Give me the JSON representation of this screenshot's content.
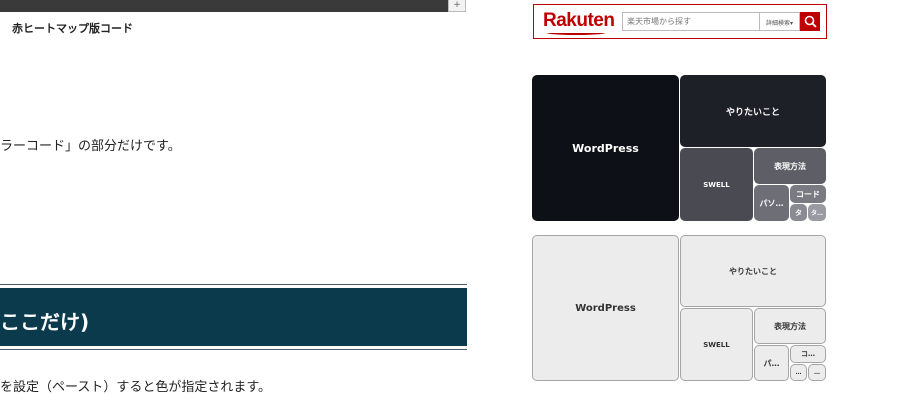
{
  "article": {
    "code_caption": "赤ヒートマップ版コード",
    "scroll_button_symbol": "+",
    "paragraph1": "ラーコード」の部分だけです。",
    "section_heading": "ここだけ)",
    "paragraph2": "を設定（ペースト）すると色が指定されます。"
  },
  "rakuten": {
    "logo": "Rakuten",
    "search_placeholder": "楽天市場から探す",
    "detail_search": "詳細検索▾",
    "brand_color": "#bf0000"
  },
  "treemap_dark": {
    "tiles": [
      "WordPress",
      "やりたいこと",
      "SWELL",
      "表現方法",
      "パソ…",
      "コード",
      "タ",
      "タ…"
    ],
    "colors": [
      "#0e1018",
      "#1e2028",
      "#4a4b52",
      "#5e5f66",
      "#6e6f76",
      "#7a7b82",
      "#8a8b92",
      "#9a9ba2"
    ]
  },
  "treemap_light": {
    "tiles": [
      "WordPress",
      "やりたいこと",
      "SWELL",
      "表現方法",
      "パ…",
      "コ…",
      "…",
      "…"
    ]
  },
  "icons": {
    "search": "search-icon"
  }
}
